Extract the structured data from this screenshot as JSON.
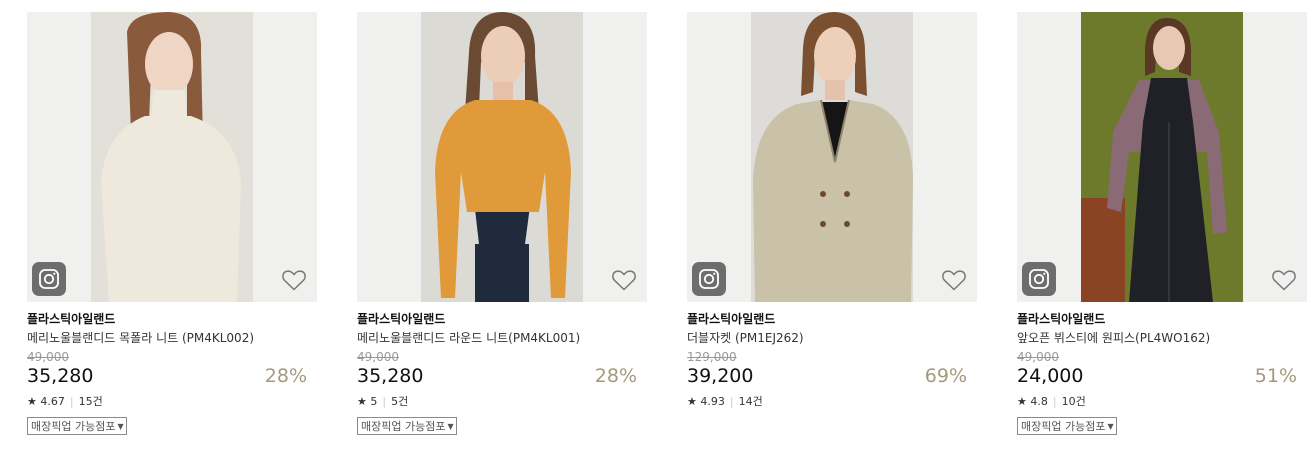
{
  "products": [
    {
      "brand": "플라스틱아일랜드",
      "name": "메리노울블랜디드 목폴라 니트 (PM4KL002)",
      "original_price": "49,000",
      "price": "35,280",
      "discount": "28%",
      "rating": "4.67",
      "reviews": "15건",
      "pickup_label": "매장픽업 가능점포",
      "photo_bg": "#e3e0da",
      "garment_color": "#efe9dd"
    },
    {
      "brand": "플라스틱아일랜드",
      "name": "메리노울블랜디드 라운드 니트(PM4KL001)",
      "original_price": "49,000",
      "price": "35,280",
      "discount": "28%",
      "rating": "5",
      "reviews": "5건",
      "pickup_label": "매장픽업 가능점포",
      "photo_bg": "#dcdad5",
      "garment_color": "#e09a3a"
    },
    {
      "brand": "플라스틱아일랜드",
      "name": "더블자켓 (PM1EJ262)",
      "original_price": "129,000",
      "price": "39,200",
      "discount": "69%",
      "rating": "4.93",
      "reviews": "14건",
      "pickup_label": "",
      "photo_bg": "#dedcd8",
      "garment_color": "#c9c2a8"
    },
    {
      "brand": "플라스틱아일랜드",
      "name": "앞오픈 뷔스티에 원피스(PL4WO162)",
      "original_price": "49,000",
      "price": "24,000",
      "discount": "51%",
      "rating": "4.8",
      "reviews": "10건",
      "pickup_label": "매장픽업 가능점포",
      "photo_bg": "#6d7a2c",
      "garment_color": "#1f2126"
    }
  ],
  "colors": {
    "discount": "#a49a7a",
    "image_bg": "#f0f0ef",
    "instagram_button": "#6d6d6d"
  },
  "icons": {
    "instagram": "instagram-icon",
    "wishlist": "heart-outline-icon",
    "rating": "star-icon",
    "dropdown": "caret-down-icon"
  }
}
